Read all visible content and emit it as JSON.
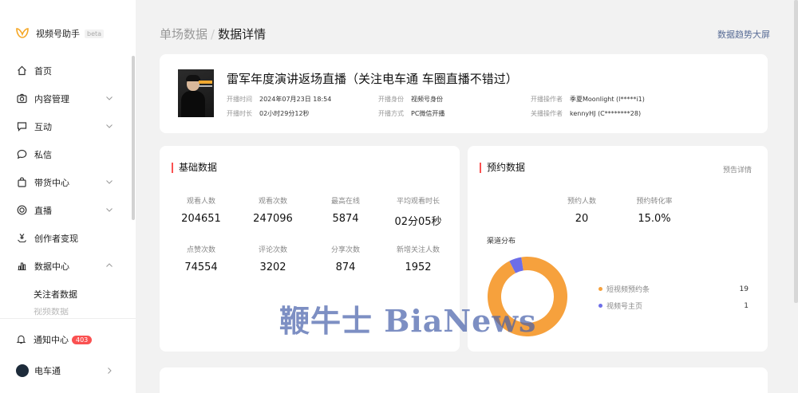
{
  "app": {
    "name": "视频号助手",
    "beta": "beta"
  },
  "sidebar": {
    "items": [
      {
        "label": "首页"
      },
      {
        "label": "内容管理"
      },
      {
        "label": "互动"
      },
      {
        "label": "私信"
      },
      {
        "label": "带货中心"
      },
      {
        "label": "直播"
      },
      {
        "label": "创作者变现"
      },
      {
        "label": "数据中心"
      }
    ],
    "sub_items": [
      "关注者数据",
      "视频数据"
    ],
    "notification": {
      "label": "通知中心",
      "count": "403"
    },
    "account": {
      "name": "电车通"
    }
  },
  "header": {
    "crumb_parent": "单场数据",
    "crumb_separator": "/",
    "crumb_current": "数据详情",
    "trend_link": "数据趋势大屏"
  },
  "live": {
    "title": "雷军年度演讲返场直播（关注电车通 车圈直播不错过）",
    "start_time_label": "开播时间",
    "start_time": "2024年07月23日 18:54",
    "duration_label": "开播时长",
    "duration": "02小时29分12秒",
    "identity_label": "开播身份",
    "identity": "视频号身份",
    "method_label": "开播方式",
    "method": "PC微信开播",
    "operator_label": "开播操作者",
    "operator": "季夏Moonlight (l*****i1)",
    "closer_label": "关播操作者",
    "closer": "kennyHJ (C********28)"
  },
  "basic": {
    "title": "基础数据",
    "stats": [
      {
        "label": "观看人数",
        "value": "204651"
      },
      {
        "label": "观看次数",
        "value": "247096"
      },
      {
        "label": "最高在线",
        "value": "5874"
      },
      {
        "label": "平均观看时长",
        "value": "02分05秒"
      },
      {
        "label": "点赞次数",
        "value": "74554"
      },
      {
        "label": "评论次数",
        "value": "3202"
      },
      {
        "label": "分享次数",
        "value": "874"
      },
      {
        "label": "新增关注人数",
        "value": "1952"
      }
    ]
  },
  "reserve": {
    "title": "预约数据",
    "detail_link": "预告详情",
    "stats": [
      {
        "label": "预约人数",
        "value": "20"
      },
      {
        "label": "预约转化率",
        "value": "15.0%"
      }
    ],
    "channel_label": "渠道分布",
    "channels": [
      {
        "name": "短视频预约条",
        "count": "19",
        "value": 19,
        "color": "#f6a13d"
      },
      {
        "name": "视频号主页",
        "count": "1",
        "value": 1,
        "color": "#6d6ee8"
      }
    ]
  },
  "watermark": "鞭牛士 BiaNews",
  "colors": {
    "accent_red": "#fa5151",
    "link_blue": "#576b95",
    "donut_orange": "#f6a13d",
    "donut_purple": "#6d6ee8"
  }
}
